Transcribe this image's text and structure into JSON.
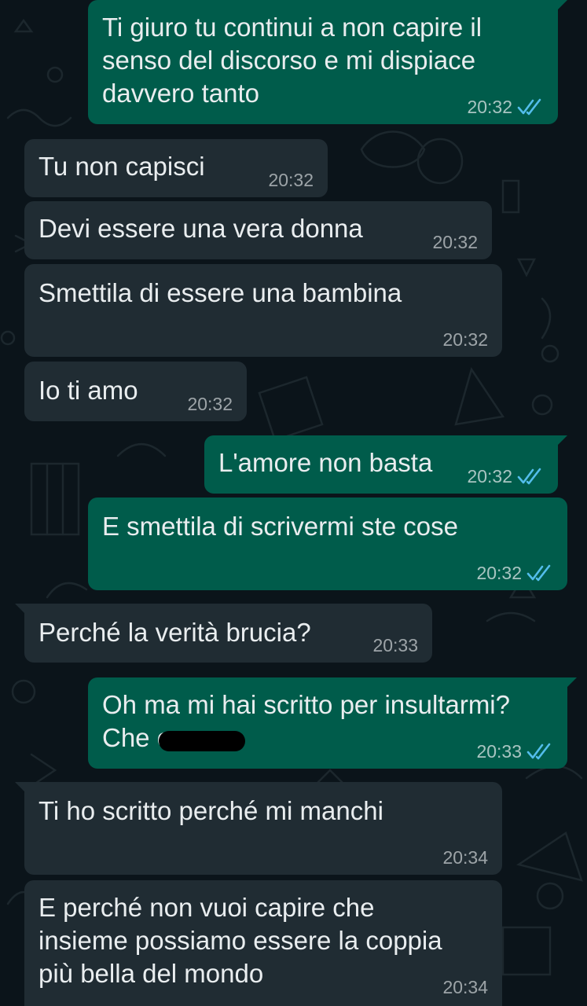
{
  "colors": {
    "background": "#0b141a",
    "incoming_bubble": "#202c33",
    "outgoing_bubble": "#005c4b",
    "read_ticks": "#53bdeb"
  },
  "messages": [
    {
      "dir": "out",
      "text": "Ti giuro tu continui a non capire il\nsenso del discorso e mi dispiace\ndavvero tanto",
      "time": "20:32",
      "status_icon": "double-check-read-icon"
    },
    {
      "dir": "in",
      "text": "Tu non capisci",
      "time": "20:32"
    },
    {
      "dir": "in",
      "text": "Devi essere una vera donna",
      "time": "20:32"
    },
    {
      "dir": "in",
      "text": "Smettila di essere una bambina",
      "time": "20:32"
    },
    {
      "dir": "in",
      "text": "Io ti amo",
      "time": "20:32"
    },
    {
      "dir": "out",
      "text": "L'amore non basta",
      "time": "20:32",
      "status_icon": "double-check-read-icon"
    },
    {
      "dir": "out",
      "text": "E smettila di scrivermi ste cose",
      "time": "20:32",
      "status_icon": "double-check-read-icon"
    },
    {
      "dir": "in",
      "text": "Perché la verità brucia?",
      "time": "20:33"
    },
    {
      "dir": "out",
      "text": "Oh ma mi hai scritto per insultarmi?\nChe c",
      "time": "20:33",
      "status_icon": "double-check-read-icon",
      "redacted": true
    },
    {
      "dir": "in",
      "text": "Ti ho scritto perché mi manchi",
      "time": "20:34"
    },
    {
      "dir": "in",
      "text": "E perché non vuoi capire che\ninsieme possiamo essere la coppia\npiù bella del mondo",
      "time": "20:34"
    }
  ]
}
